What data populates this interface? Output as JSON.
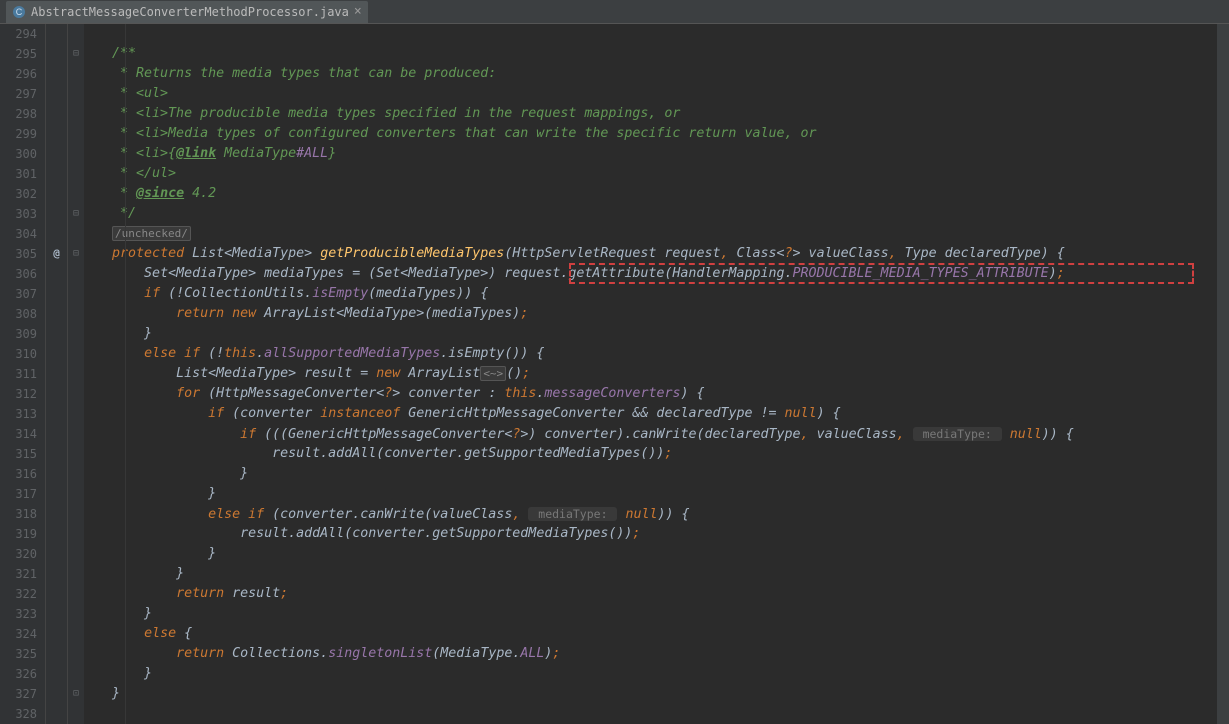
{
  "tab": {
    "filename": "AbstractMessageConverterMethodProcessor.java"
  },
  "gutter": {
    "start": 294,
    "end": 328,
    "annotation_line": 305,
    "annotation_symbol": "@"
  },
  "fold": {
    "open_lines": [
      295,
      303,
      305
    ],
    "close_lines": [
      327
    ]
  },
  "code": {
    "294": [
      [
        "",
        ""
      ]
    ],
    "295": [
      [
        "c-doc",
        "   /**"
      ]
    ],
    "296": [
      [
        "c-doc",
        "    * Returns the media types that can be produced:"
      ]
    ],
    "297": [
      [
        "c-doc",
        "    * <ul>"
      ]
    ],
    "298": [
      [
        "c-doc",
        "    * <li>The producible media types specified in the request mappings, or"
      ]
    ],
    "299": [
      [
        "c-doc",
        "    * <li>Media types of configured converters that can write the specific return value, or"
      ]
    ],
    "300": [
      [
        "c-doc",
        "    * <li>{"
      ],
      [
        "c-doctag",
        "@link"
      ],
      [
        "c-doc",
        " MediaType"
      ],
      [
        "c-static",
        "#ALL"
      ],
      [
        "c-doc",
        "}"
      ]
    ],
    "301": [
      [
        "c-doc",
        "    * </ul>"
      ]
    ],
    "302": [
      [
        "c-doc",
        "    * "
      ],
      [
        "c-doctag",
        "@since"
      ],
      [
        "c-doc",
        " 4.2"
      ]
    ],
    "303": [
      [
        "c-doc",
        "    */"
      ]
    ],
    "304": [
      [
        "c-fold",
        "/unchecked/"
      ]
    ],
    "305": [
      [
        "c-keyword",
        "protected "
      ],
      [
        "",
        "List<MediaType> "
      ],
      [
        "c-method",
        "getProducibleMediaTypes"
      ],
      [
        "",
        "(HttpServletRequest request"
      ],
      [
        "c-keyword",
        ", "
      ],
      [
        "",
        "Class<"
      ],
      [
        "c-keyword",
        "?"
      ],
      [
        "",
        "> valueClass"
      ],
      [
        "c-keyword",
        ", "
      ],
      [
        "",
        "Type declaredType) {"
      ]
    ],
    "306": [
      [
        "",
        "    Set<MediaType> mediaTypes = (Set<MediaType>) request.getAttribute(HandlerMapping."
      ],
      [
        "c-static",
        "PRODUCIBLE_MEDIA_TYPES_ATTRIBUTE"
      ],
      [
        "",
        ")"
      ],
      [
        "c-keyword",
        ";"
      ]
    ],
    "307": [
      [
        "",
        "    "
      ],
      [
        "c-keyword",
        "if "
      ],
      [
        "",
        "(!CollectionUtils."
      ],
      [
        "c-static",
        "isEmpty"
      ],
      [
        "",
        "(mediaTypes)) {"
      ]
    ],
    "308": [
      [
        "",
        "        "
      ],
      [
        "c-keyword",
        "return new "
      ],
      [
        "",
        "ArrayList<MediaType>(mediaTypes)"
      ],
      [
        "c-keyword",
        ";"
      ]
    ],
    "309": [
      [
        "",
        "    }"
      ]
    ],
    "310": [
      [
        "",
        "    "
      ],
      [
        "c-keyword",
        "else if "
      ],
      [
        "",
        "(!"
      ],
      [
        "c-keyword",
        "this"
      ],
      [
        "",
        "."
      ],
      [
        "c-purple",
        "allSupportedMediaTypes"
      ],
      [
        "",
        ".isEmpty()) {"
      ]
    ],
    "311": [
      [
        "",
        "        List<MediaType> result = "
      ],
      [
        "c-keyword",
        "new "
      ],
      [
        "",
        "ArrayList"
      ],
      [
        "c-fold",
        "<~>"
      ],
      [
        "",
        "()"
      ],
      [
        "c-keyword",
        ";"
      ]
    ],
    "312": [
      [
        "",
        "        "
      ],
      [
        "c-keyword",
        "for "
      ],
      [
        "",
        "(HttpMessageConverter<"
      ],
      [
        "c-keyword",
        "?"
      ],
      [
        "",
        "> converter : "
      ],
      [
        "c-keyword",
        "this"
      ],
      [
        "",
        "."
      ],
      [
        "c-purple",
        "messageConverters"
      ],
      [
        "",
        ") {"
      ]
    ],
    "313": [
      [
        "",
        "            "
      ],
      [
        "c-keyword",
        "if "
      ],
      [
        "",
        "(converter "
      ],
      [
        "c-keyword",
        "instanceof "
      ],
      [
        "",
        "GenericHttpMessageConverter && declaredType != "
      ],
      [
        "c-keyword",
        "null"
      ],
      [
        "",
        ") {"
      ]
    ],
    "314": [
      [
        "",
        "                "
      ],
      [
        "c-keyword",
        "if "
      ],
      [
        "",
        "(((GenericHttpMessageConverter<"
      ],
      [
        "c-keyword",
        "?"
      ],
      [
        "",
        ">) converter).canWrite(declaredType"
      ],
      [
        "c-keyword",
        ", "
      ],
      [
        "",
        "valueClass"
      ],
      [
        "c-keyword",
        ", "
      ],
      [
        "c-hint",
        " mediaType: "
      ],
      [
        "c-keyword",
        " null"
      ],
      [
        "",
        ")) {"
      ]
    ],
    "315": [
      [
        "",
        "                    result.addAll(converter.getSupportedMediaTypes())"
      ],
      [
        "c-keyword",
        ";"
      ]
    ],
    "316": [
      [
        "",
        "                }"
      ]
    ],
    "317": [
      [
        "",
        "            }"
      ]
    ],
    "318": [
      [
        "",
        "            "
      ],
      [
        "c-keyword",
        "else if "
      ],
      [
        "",
        "(converter.canWrite(valueClass"
      ],
      [
        "c-keyword",
        ", "
      ],
      [
        "c-hint",
        " mediaType: "
      ],
      [
        "c-keyword",
        " null"
      ],
      [
        "",
        ")) {"
      ]
    ],
    "319": [
      [
        "",
        "                result.addAll(converter.getSupportedMediaTypes())"
      ],
      [
        "c-keyword",
        ";"
      ]
    ],
    "320": [
      [
        "",
        "            }"
      ]
    ],
    "321": [
      [
        "",
        "        }"
      ]
    ],
    "322": [
      [
        "",
        "        "
      ],
      [
        "c-keyword",
        "return "
      ],
      [
        "",
        "result"
      ],
      [
        "c-keyword",
        ";"
      ]
    ],
    "323": [
      [
        "",
        "    }"
      ]
    ],
    "324": [
      [
        "",
        "    "
      ],
      [
        "c-keyword",
        "else "
      ],
      [
        "",
        "{"
      ]
    ],
    "325": [
      [
        "",
        "        "
      ],
      [
        "c-keyword",
        "return "
      ],
      [
        "",
        "Collections."
      ],
      [
        "c-static",
        "singletonList"
      ],
      [
        "",
        "(MediaType."
      ],
      [
        "c-static",
        "ALL"
      ],
      [
        "",
        ")"
      ],
      [
        "c-keyword",
        ";"
      ]
    ],
    "326": [
      [
        "",
        "    }"
      ]
    ],
    "327": [
      [
        "",
        "}"
      ]
    ],
    "328": [
      [
        "",
        ""
      ]
    ]
  },
  "highlight": {
    "line": 306,
    "text_segment": "request.getAttribute(HandlerMapping.PRODUCIBLE_MEDIA_TYPES_ATTRIBUTE)"
  }
}
